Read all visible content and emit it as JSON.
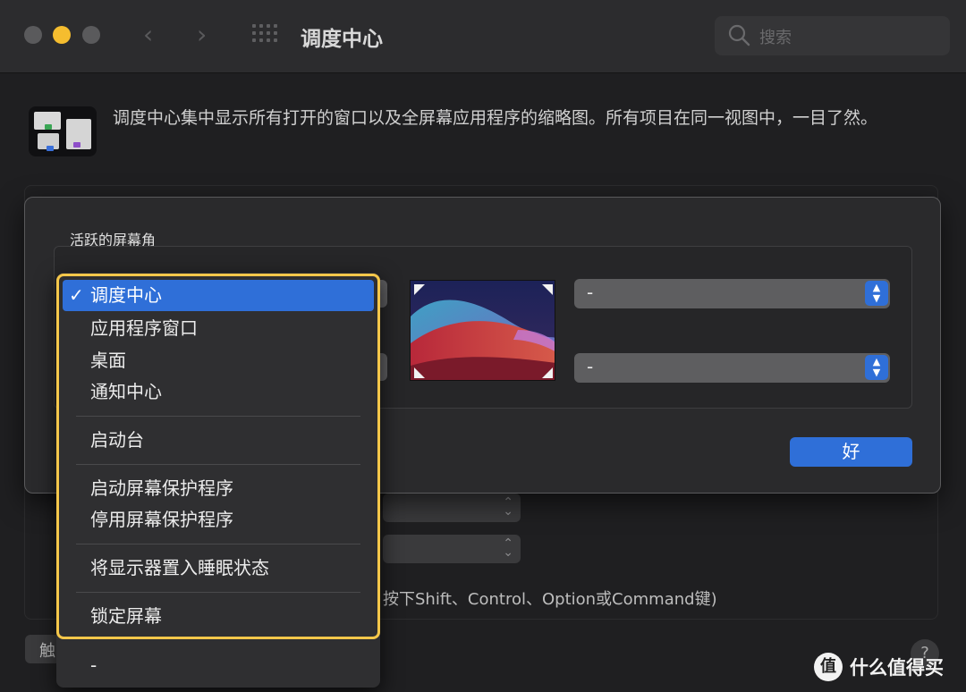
{
  "window": {
    "title": "调度中心",
    "search_placeholder": "搜索"
  },
  "header": {
    "description": "调度中心集中显示所有打开的窗口以及全屏幕应用程序的缩略图。所有项目在同一视图中，一目了然。"
  },
  "background": {
    "hint_text": "按下Shift、Control、Option或Command键)",
    "left_button_label": "触",
    "help_label": "?"
  },
  "sheet": {
    "section_label": "活跃的屏幕角",
    "top_right_value": "-",
    "bottom_right_value": "-",
    "ok_label": "好"
  },
  "dropdown": {
    "items": [
      {
        "label": "调度中心",
        "selected": true
      },
      {
        "label": "应用程序窗口",
        "selected": false
      },
      {
        "label": "桌面",
        "selected": false
      },
      {
        "label": "通知中心",
        "selected": false
      },
      {
        "label": "启动台",
        "selected": false
      },
      {
        "label": "启动屏幕保护程序",
        "selected": false
      },
      {
        "label": "停用屏幕保护程序",
        "selected": false
      },
      {
        "label": "将显示器置入睡眠状态",
        "selected": false
      },
      {
        "label": "锁定屏幕",
        "selected": false
      },
      {
        "label": "-",
        "selected": false
      }
    ],
    "checkmark": "✓",
    "highlight_color": "#f5c74a"
  },
  "watermark": {
    "logo": "值",
    "text": "什么值得买"
  },
  "colors": {
    "accent": "#2f6fd8",
    "minimize": "#f5bd2f"
  }
}
